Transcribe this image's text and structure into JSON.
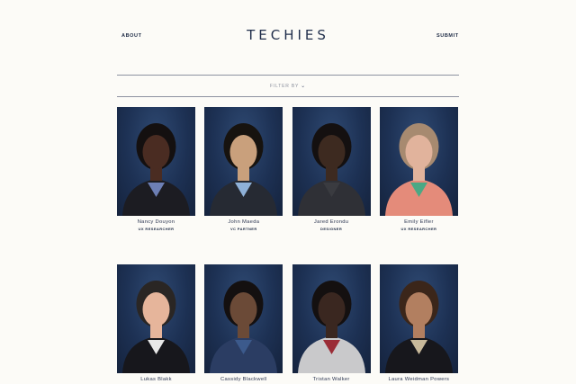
{
  "header": {
    "about_label": "ABOUT",
    "logo_text": "TECHIES",
    "submit_label": "SUBMIT"
  },
  "filter": {
    "label": "FILTER BY"
  },
  "people": [
    {
      "name": "Nancy Douyon",
      "role": "UX RESEARCHER",
      "skin": "#4a2c22",
      "hair": "#141010",
      "shirt": "#1c1c22",
      "accent": "#6d7fb5"
    },
    {
      "name": "John Maeda",
      "role": "VC PARTNER",
      "skin": "#c9a07c",
      "hair": "#17130f",
      "shirt": "#262a33",
      "accent": "#8fb1d8"
    },
    {
      "name": "Jared Erondu",
      "role": "DESIGNER",
      "skin": "#3d2a20",
      "hair": "#141010",
      "shirt": "#2f3036",
      "accent": "#3a3b40"
    },
    {
      "name": "Emily Eifler",
      "role": "UX RESEARCHER",
      "skin": "#e1b39c",
      "hair": "#a78a70",
      "shirt": "#e48b7a",
      "accent": "#4aa884"
    },
    {
      "name": "Lukas Blakk",
      "role": "",
      "skin": "#e6b59b",
      "hair": "#2a2624",
      "shirt": "#17171c",
      "accent": "#e8e8e8"
    },
    {
      "name": "Cassidy Blackwell",
      "role": "",
      "skin": "#6b4a37",
      "hair": "#141010",
      "shirt": "#2b3d63",
      "accent": "#3c5a8c"
    },
    {
      "name": "Tristan Walker",
      "role": "",
      "skin": "#3a2720",
      "hair": "#141010",
      "shirt": "#c9c9cb",
      "accent": "#9b2c36"
    },
    {
      "name": "Laura Weidman Powers",
      "role": "",
      "skin": "#b27f60",
      "hair": "#3b261a",
      "shirt": "#17171c",
      "accent": "#c8b99b"
    }
  ]
}
